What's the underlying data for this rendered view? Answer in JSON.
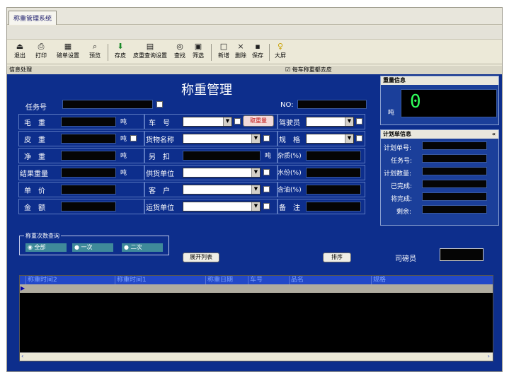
{
  "tab": "称重管理系统",
  "toolbar": {
    "buttons": [
      {
        "label": "退出",
        "icon": "exit-icon"
      },
      {
        "label": "打印",
        "icon": "print-icon"
      },
      {
        "label": "磅单设置",
        "icon": "ticket-settings-icon"
      },
      {
        "label": "预览",
        "icon": "preview-icon"
      },
      {
        "label": "存皮",
        "icon": "save-tare-icon"
      },
      {
        "label": "皮重查询设置",
        "icon": "tare-query-icon"
      },
      {
        "label": "查找",
        "icon": "binoculars-icon"
      },
      {
        "label": "筛选",
        "icon": "filter-icon"
      },
      {
        "label": "新增",
        "icon": "new-icon"
      },
      {
        "label": "删除",
        "icon": "delete-icon"
      },
      {
        "label": "保存",
        "icon": "save-icon"
      },
      {
        "label": "大屏",
        "icon": "big-screen-icon"
      }
    ]
  },
  "infobar": {
    "label": "信息处理",
    "checkbox_label": "每车称重都去皮",
    "checkbox_checked": true
  },
  "form": {
    "title": "称重管理",
    "task_no_label": "任务号",
    "no_label": "NO:",
    "gross_label": "毛　重",
    "tare_label": "皮　重",
    "net_label": "净　重",
    "settle_label": "结果重量",
    "price_label": "单　价",
    "amount_label": "金　额",
    "unit_ton": "吨",
    "car_label": "车　号",
    "goods_label": "货物名称",
    "deduct_label": "另　扣",
    "supplier_label": "供货单位",
    "customer_label": "客　户",
    "transport_label": "运货单位",
    "fetch_weight_button": "取重量",
    "driver_label": "驾驶员",
    "spec_label": "规　格",
    "impurity_label": "杂质(%)",
    "water_label": "水份(%)",
    "oil_label": "含油(%)",
    "remark_label": "备　注"
  },
  "weight_info": {
    "title": "重量信息",
    "value": "0",
    "unit": "吨"
  },
  "plan_info": {
    "title": "计划单信息",
    "fields": [
      "计划单号:",
      "任务号:",
      "计划数量:",
      "已完成:",
      "将完成:",
      "剩余:"
    ]
  },
  "query": {
    "title": "称重次数查询",
    "options": [
      "全部",
      "一次",
      "二次"
    ],
    "selected": "全部",
    "expand_button": "展开列表",
    "sort_button": "排序",
    "operator_label": "司磅员"
  },
  "grid": {
    "columns": [
      "称重时间2",
      "称重时间1",
      "称重日期",
      "车号",
      "品名",
      "规格"
    ]
  }
}
